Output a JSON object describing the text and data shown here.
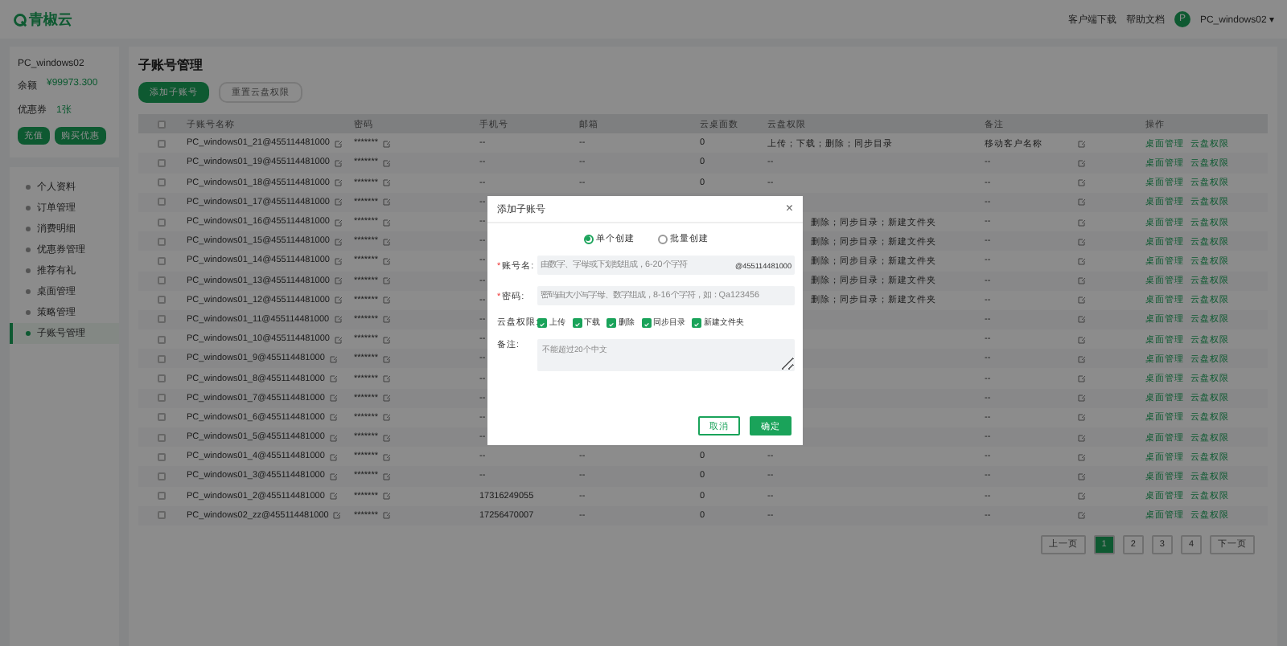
{
  "header": {
    "logo": "青椒云",
    "links": [
      "客户端下载",
      "帮助文档"
    ],
    "avatar": "P",
    "user": "PC_windows02",
    "caret": "▾"
  },
  "account_card": {
    "name": "PC_windows02",
    "fields": [
      {
        "label": "余额",
        "value": "¥99973.300"
      },
      {
        "label": "优惠券",
        "value": "1张"
      }
    ],
    "buttons": [
      "充值",
      "购买优惠"
    ]
  },
  "sidebar": {
    "items": [
      {
        "label": "个人资料",
        "selected": false
      },
      {
        "label": "订单管理",
        "selected": false
      },
      {
        "label": "消费明细",
        "selected": false
      },
      {
        "label": "优惠券管理",
        "selected": false
      },
      {
        "label": "推荐有礼",
        "selected": false
      },
      {
        "label": "桌面管理",
        "selected": false
      },
      {
        "label": "策略管理",
        "selected": false
      },
      {
        "label": "子账号管理",
        "selected": true
      }
    ]
  },
  "page": {
    "title": "子账号管理",
    "primary_button": "添加子账号",
    "secondary_button": {
      "label": "重置云盘权限",
      "disabled": true
    }
  },
  "table": {
    "select_all": {
      "checked": false
    },
    "columns": [
      "子账号名称",
      "密码",
      "手机号",
      "邮箱",
      "云桌面数",
      "云盘权限",
      "备注",
      "操作"
    ],
    "rows": [
      {
        "name": "PC_windows01_21@455114481000",
        "password": "*******",
        "phone": "--",
        "email": "--",
        "desktops": "0",
        "permissions": "上传；下载；删除；同步目录",
        "note": "移动客户名称",
        "checked": false,
        "actions": [
          "桌面管理",
          "云盘权限"
        ]
      },
      {
        "name": "PC_windows01_19@455114481000",
        "password": "*******",
        "phone": "--",
        "email": "--",
        "desktops": "0",
        "permissions": "--",
        "note": "--",
        "checked": false,
        "actions": [
          "桌面管理",
          "云盘权限"
        ]
      },
      {
        "name": "PC_windows01_18@455114481000",
        "password": "*******",
        "phone": "--",
        "email": "--",
        "desktops": "0",
        "permissions": "--",
        "note": "--",
        "checked": false,
        "actions": [
          "桌面管理",
          "云盘权限"
        ]
      },
      {
        "name": "PC_windows01_17@455114481000",
        "password": "*******",
        "phone": "--",
        "note": "--",
        "checked": false,
        "actions": [
          "桌面管理",
          "云盘权限"
        ]
      },
      {
        "name": "PC_windows01_16@455114481000",
        "password": "*******",
        "phone": "--",
        "permissions_tail": "删除；同步目录；新建文件夹",
        "note": "--",
        "checked": false,
        "actions": [
          "桌面管理",
          "云盘权限"
        ]
      },
      {
        "name": "PC_windows01_15@455114481000",
        "password": "*******",
        "phone": "--",
        "permissions_tail": "删除；同步目录；新建文件夹",
        "note": "--",
        "checked": false,
        "actions": [
          "桌面管理",
          "云盘权限"
        ]
      },
      {
        "name": "PC_windows01_14@455114481000",
        "password": "*******",
        "phone": "--",
        "permissions_tail": "删除；同步目录；新建文件夹",
        "note": "--",
        "checked": false,
        "actions": [
          "桌面管理",
          "云盘权限"
        ]
      },
      {
        "name": "PC_windows01_13@455114481000",
        "password": "*******",
        "phone": "--",
        "permissions_tail": "删除；同步目录；新建文件夹",
        "note": "--",
        "checked": false,
        "actions": [
          "桌面管理",
          "云盘权限"
        ]
      },
      {
        "name": "PC_windows01_12@455114481000",
        "password": "*******",
        "phone": "--",
        "permissions_tail": "删除；同步目录；新建文件夹",
        "note": "--",
        "checked": false,
        "actions": [
          "桌面管理",
          "云盘权限"
        ]
      },
      {
        "name": "PC_windows01_11@455114481000",
        "password": "*******",
        "phone": "--",
        "note": "--",
        "checked": false,
        "actions": [
          "桌面管理",
          "云盘权限"
        ]
      },
      {
        "name": "PC_windows01_10@455114481000",
        "password": "*******",
        "phone": "--",
        "note": "--",
        "checked": false,
        "actions": [
          "桌面管理",
          "云盘权限"
        ]
      },
      {
        "name": "PC_windows01_9@455114481000",
        "password": "*******",
        "phone": "--",
        "note": "--",
        "checked": false,
        "actions": [
          "桌面管理",
          "云盘权限"
        ]
      },
      {
        "name": "PC_windows01_8@455114481000",
        "password": "*******",
        "phone": "--",
        "note": "--",
        "checked": false,
        "actions": [
          "桌面管理",
          "云盘权限"
        ]
      },
      {
        "name": "PC_windows01_7@455114481000",
        "password": "*******",
        "phone": "--",
        "note": "--",
        "checked": false,
        "actions": [
          "桌面管理",
          "云盘权限"
        ]
      },
      {
        "name": "PC_windows01_6@455114481000",
        "password": "*******",
        "phone": "--",
        "note": "--",
        "checked": false,
        "actions": [
          "桌面管理",
          "云盘权限"
        ]
      },
      {
        "name": "PC_windows01_5@455114481000",
        "password": "*******",
        "phone": "--",
        "note": "--",
        "checked": false,
        "actions": [
          "桌面管理",
          "云盘权限"
        ]
      },
      {
        "name": "PC_windows01_4@455114481000",
        "password": "*******",
        "phone": "--",
        "email": "--",
        "desktops": "0",
        "permissions": "--",
        "note": "--",
        "checked": false,
        "actions": [
          "桌面管理",
          "云盘权限"
        ]
      },
      {
        "name": "PC_windows01_3@455114481000",
        "password": "*******",
        "phone": "--",
        "email": "--",
        "desktops": "0",
        "permissions": "--",
        "note": "--",
        "checked": false,
        "actions": [
          "桌面管理",
          "云盘权限"
        ]
      },
      {
        "name": "PC_windows01_2@455114481000",
        "password": "*******",
        "phone": "17316249055",
        "email": "--",
        "desktops": "0",
        "permissions": "--",
        "note": "--",
        "checked": false,
        "actions": [
          "桌面管理",
          "云盘权限"
        ]
      },
      {
        "name": "PC_windows02_zz@455114481000",
        "password": "*******",
        "phone": "17256470007",
        "email": "--",
        "desktops": "0",
        "permissions": "--",
        "note": "--",
        "checked": false,
        "actions": [
          "桌面管理",
          "云盘权限"
        ]
      }
    ]
  },
  "pagination": {
    "prev": "上一页",
    "pages": [
      {
        "label": "1",
        "selected": true
      },
      {
        "label": "2",
        "selected": false
      },
      {
        "label": "3",
        "selected": false
      },
      {
        "label": "4",
        "selected": false
      }
    ],
    "next": "下一页"
  },
  "dialog": {
    "title": "添加子账号",
    "close": "×",
    "modes": [
      {
        "label": "单个创建",
        "selected": true
      },
      {
        "label": "批量创建",
        "selected": false
      }
    ],
    "account": {
      "marker": "*",
      "label": "账号名:",
      "placeholder": "由数字、字母或下划线组成，6-20个字符",
      "suffix": "@455114481000"
    },
    "password": {
      "marker": "*",
      "label": "密码:",
      "placeholder": "密码由大小写字母、数字组成，8-16个字符，如：Qa123456"
    },
    "permissions": {
      "label": "云盘权限:",
      "options": [
        {
          "label": "上传",
          "checked": true
        },
        {
          "label": "下载",
          "checked": true
        },
        {
          "label": "删除",
          "checked": true
        },
        {
          "label": "同步目录",
          "checked": true
        },
        {
          "label": "新建文件夹",
          "checked": true
        }
      ]
    },
    "note": {
      "label": "备注:",
      "placeholder": "不能超过20个中文"
    },
    "cancel": "取消",
    "confirm": "确定"
  }
}
